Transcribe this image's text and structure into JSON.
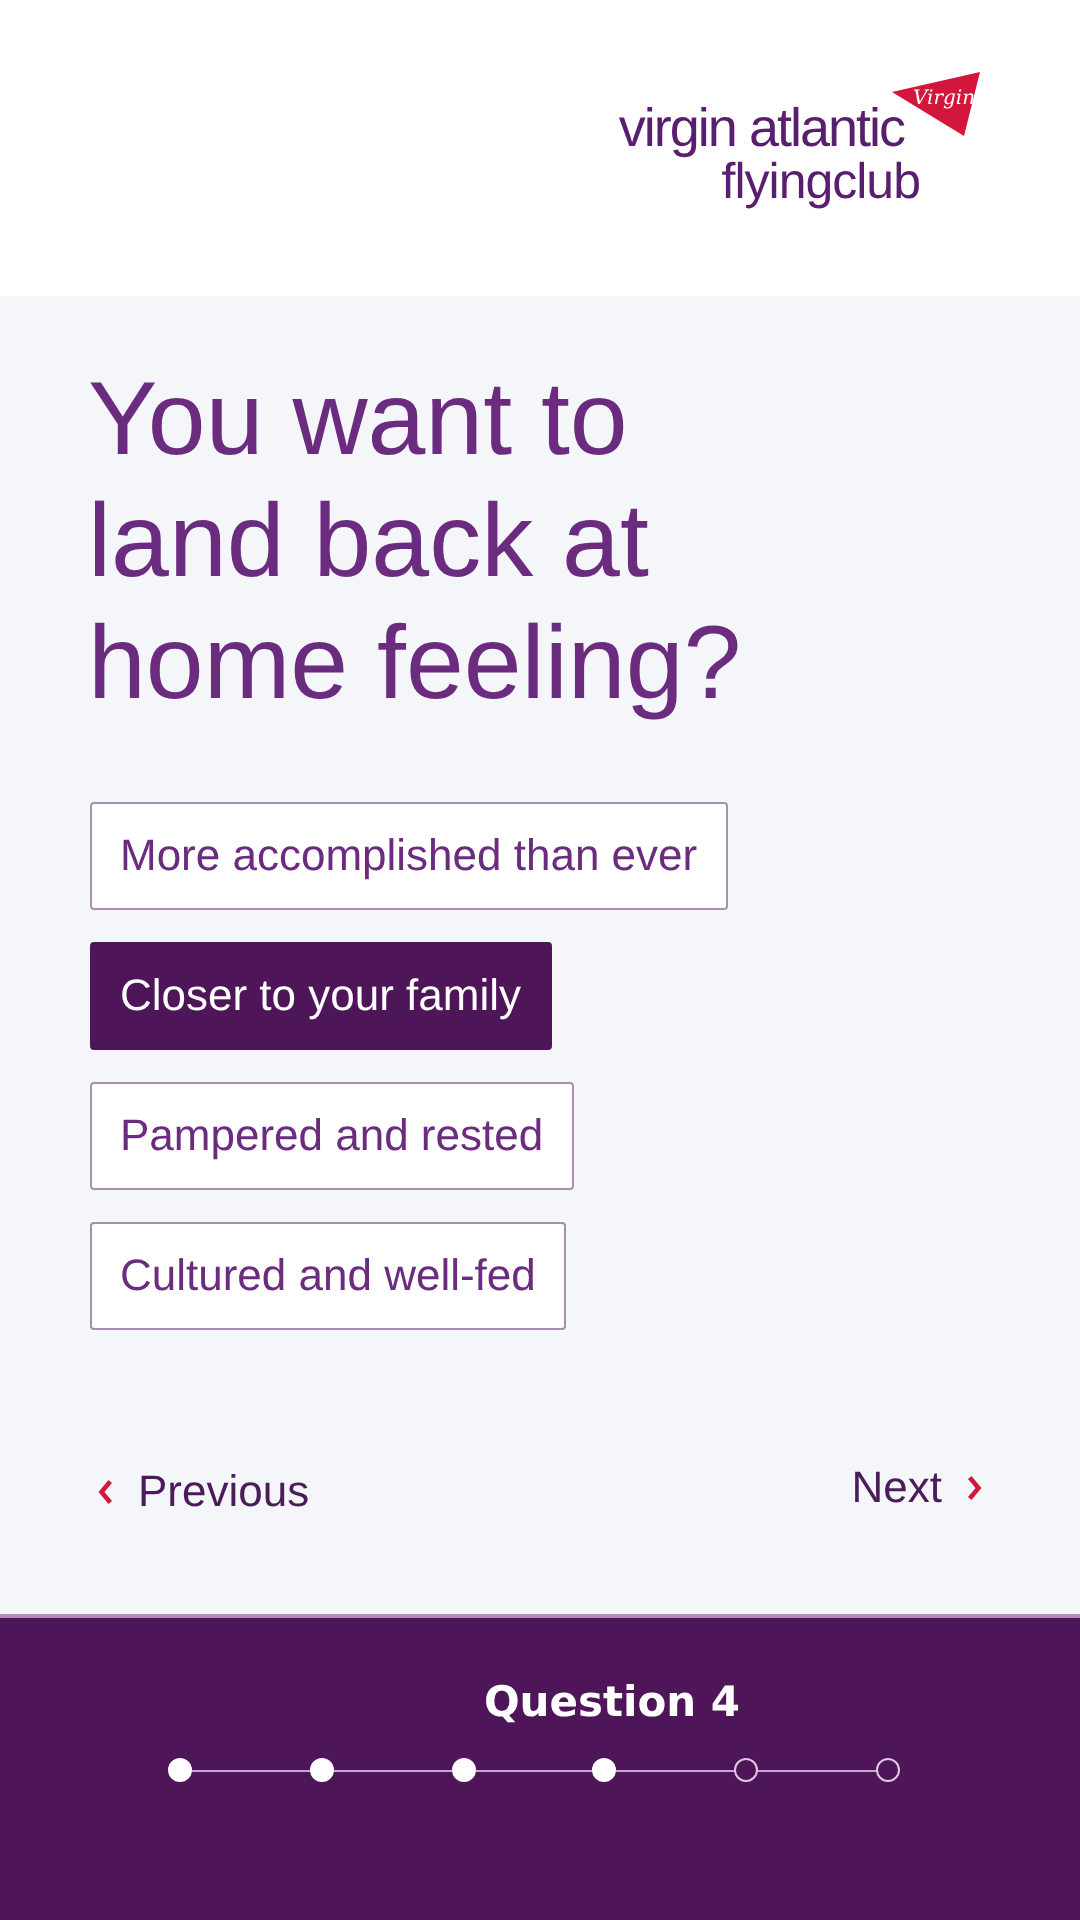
{
  "logo": {
    "brand": "virgin atlantic",
    "program": "flyingclub",
    "tail_text": "Virgin"
  },
  "question": "You want to land back at home feeling?",
  "options": [
    {
      "label": "More accomplished than ever",
      "selected": false
    },
    {
      "label": "Closer to your family",
      "selected": true
    },
    {
      "label": "Pampered and rested",
      "selected": false
    },
    {
      "label": "Cultured and well-fed",
      "selected": false
    }
  ],
  "nav": {
    "previous": "Previous",
    "next": "Next"
  },
  "progress": {
    "label": "Question 4",
    "steps": [
      {
        "done": true
      },
      {
        "done": true
      },
      {
        "done": true
      },
      {
        "done": true
      },
      {
        "done": false
      },
      {
        "done": false
      }
    ]
  }
}
